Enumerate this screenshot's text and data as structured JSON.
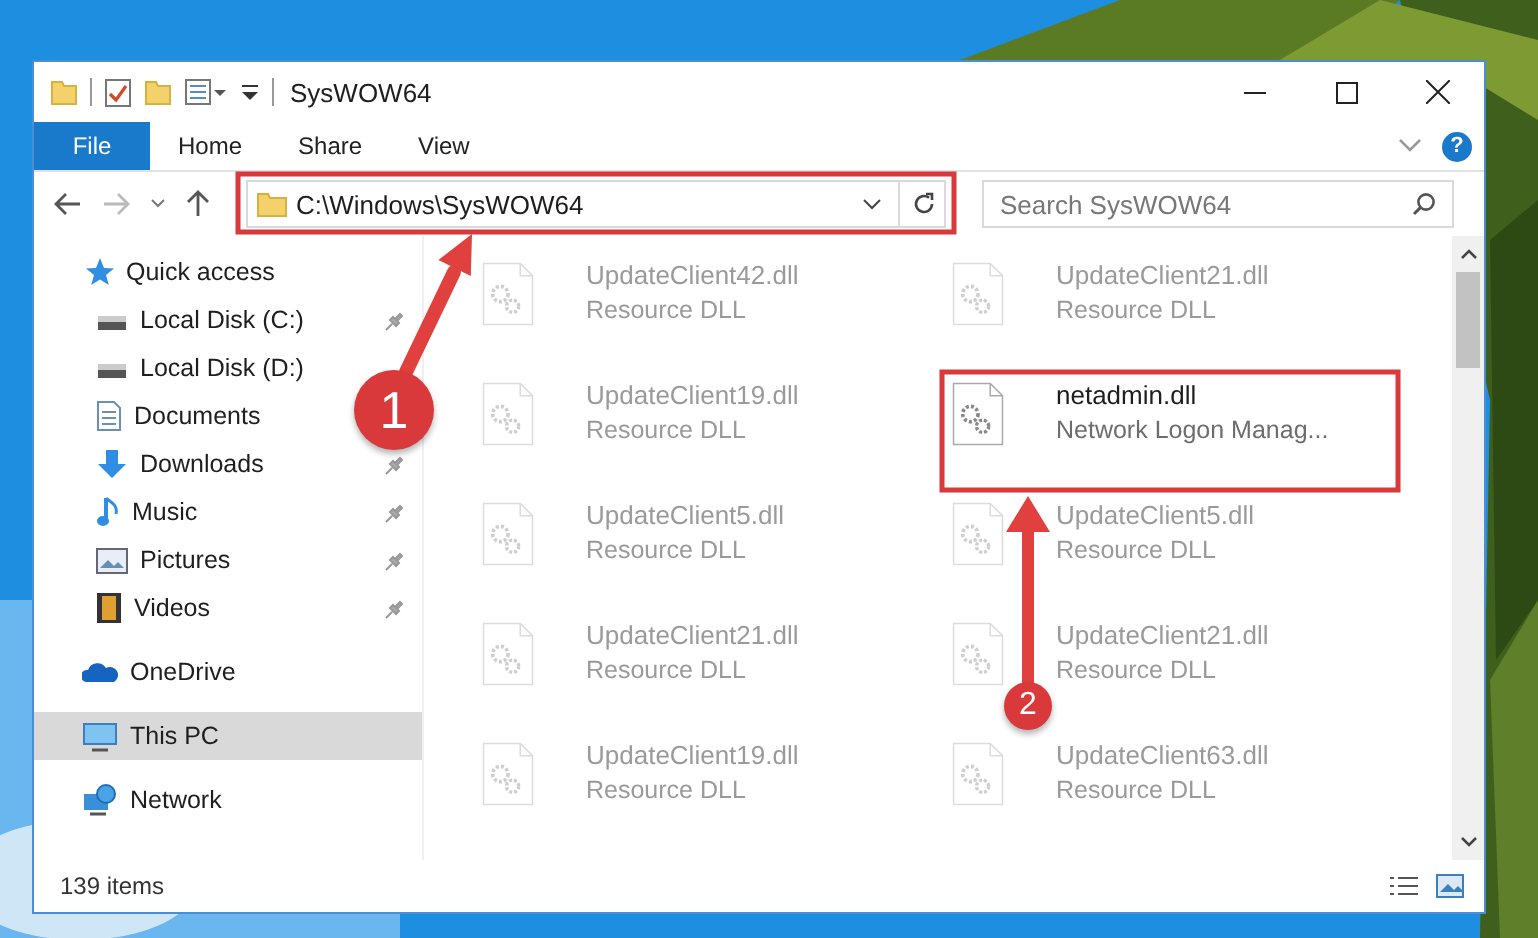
{
  "window": {
    "title": "SysWOW64"
  },
  "ribbon": {
    "tabs": [
      {
        "label": "File",
        "selected": true
      },
      {
        "label": "Home",
        "selected": false
      },
      {
        "label": "Share",
        "selected": false
      },
      {
        "label": "View",
        "selected": false
      }
    ],
    "help": "?"
  },
  "address": {
    "path": "C:\\Windows\\SysWOW64",
    "search_placeholder": "Search SysWOW64"
  },
  "navigation": [
    {
      "label": "Quick access",
      "kind": "star",
      "selected": false,
      "children": [
        {
          "label": "Local Disk (C:)",
          "kind": "drive",
          "pinned": true
        },
        {
          "label": "Local Disk (D:)",
          "kind": "drive",
          "pinned": false
        },
        {
          "label": "Documents",
          "kind": "document",
          "pinned": false
        },
        {
          "label": "Downloads",
          "kind": "download",
          "pinned": true
        },
        {
          "label": "Music",
          "kind": "music",
          "pinned": true
        },
        {
          "label": "Pictures",
          "kind": "pictures",
          "pinned": true
        },
        {
          "label": "Videos",
          "kind": "videos",
          "pinned": true
        }
      ]
    },
    {
      "label": "OneDrive",
      "kind": "cloud",
      "selected": false
    },
    {
      "label": "This PC",
      "kind": "pc",
      "selected": true
    },
    {
      "label": "Network",
      "kind": "network",
      "selected": false
    }
  ],
  "files": [
    {
      "name": "UpdateClient42.dll",
      "type": "Resource DLL",
      "faded": true
    },
    {
      "name": "UpdateClient21.dll",
      "type": "Resource DLL",
      "faded": true
    },
    {
      "name": "UpdateClient19.dll",
      "type": "Resource DLL",
      "faded": true
    },
    {
      "name": "netadmin.dll",
      "type": "Network Logon Manag...",
      "faded": false
    },
    {
      "name": "UpdateClient5.dll",
      "type": "Resource DLL",
      "faded": true
    },
    {
      "name": "UpdateClient5.dll",
      "type": "Resource DLL",
      "faded": true
    },
    {
      "name": "UpdateClient21.dll",
      "type": "Resource DLL",
      "faded": true
    },
    {
      "name": "UpdateClient21.dll",
      "type": "Resource DLL",
      "faded": true
    },
    {
      "name": "UpdateClient19.dll",
      "type": "Resource DLL",
      "faded": true
    },
    {
      "name": "UpdateClient63.dll",
      "type": "Resource DLL",
      "faded": true
    }
  ],
  "status_bar": {
    "item_count": "139 items"
  },
  "annotations": [
    {
      "number": "1"
    },
    {
      "number": "2"
    }
  ]
}
